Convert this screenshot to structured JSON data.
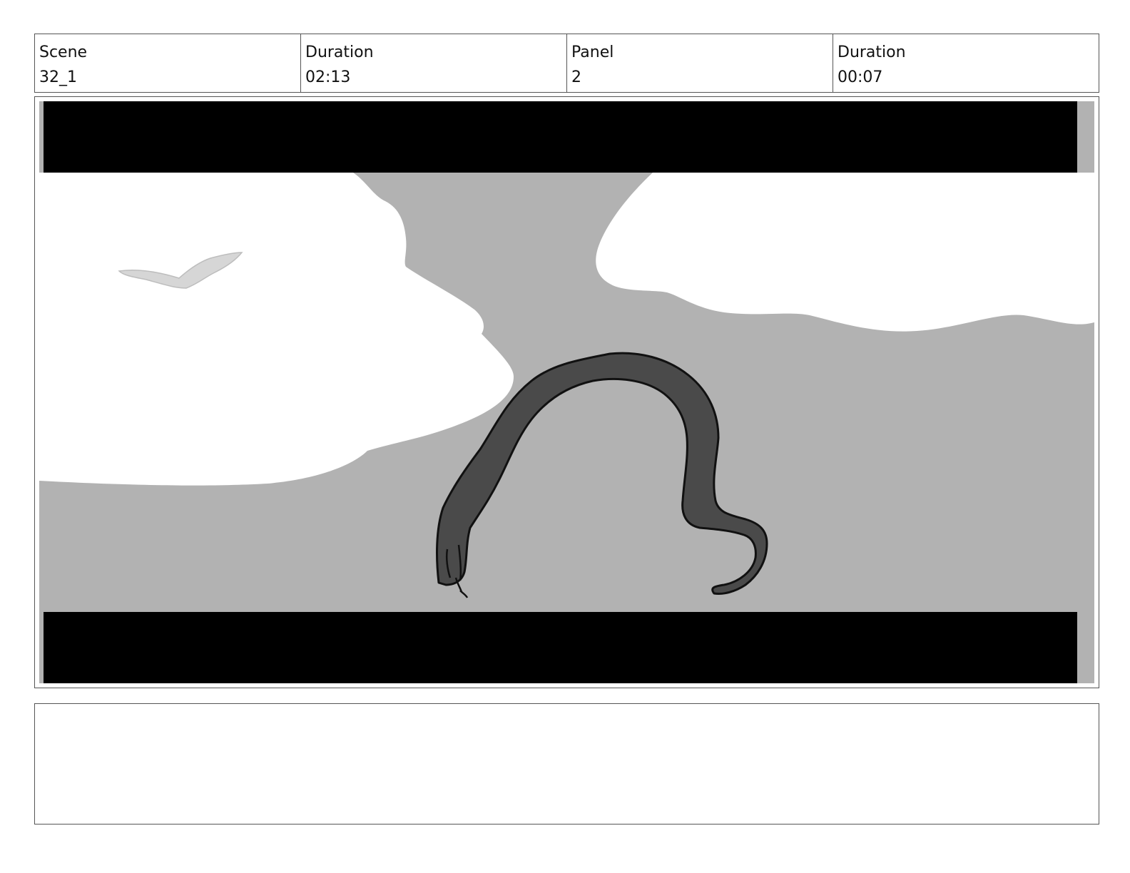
{
  "header": {
    "scene": {
      "label": "Scene",
      "value": "32_1"
    },
    "scene_duration": {
      "label": "Duration",
      "value": "02:13"
    },
    "panel": {
      "label": "Panel",
      "value": "2"
    },
    "panel_duration": {
      "label": "Duration",
      "value": "00:07"
    }
  },
  "panel_art": {
    "letterbox_color": "#000000",
    "sky_color": "#b2b2b2",
    "cloud_color": "#ffffff",
    "creature_color": "#4a4a4a",
    "outline_color": "#111111",
    "bird_color": "#d6d6d6"
  },
  "notes": {
    "text": ""
  }
}
